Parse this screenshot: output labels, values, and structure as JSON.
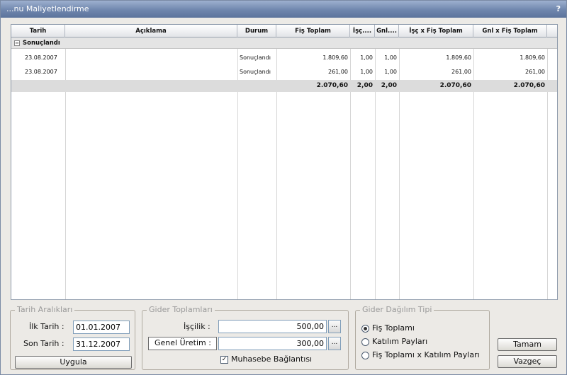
{
  "window": {
    "title": "...nu Maliyetlendirme",
    "help": "?"
  },
  "grid": {
    "columns": [
      "Tarih",
      "Açıklama",
      "Durum",
      "Fiş Toplam",
      "İşç....",
      "Gnl....",
      "İşç x Fiş Toplam",
      "Gnl x Fiş Toplam"
    ],
    "group_label": "Sonuçlandı",
    "group_toggle": "−",
    "rows": [
      {
        "tarih": "23.08.2007",
        "aciklama": "",
        "durum": "Sonuçlandı",
        "fis_toplam": "1.809,60",
        "isc": "1,00",
        "gnl": "1,00",
        "isc_x_fis": "1.809,60",
        "gnl_x_fis": "1.809,60"
      },
      {
        "tarih": "23.08.2007",
        "aciklama": "",
        "durum": "Sonuçlandı",
        "fis_toplam": "261,00",
        "isc": "1,00",
        "gnl": "1,00",
        "isc_x_fis": "261,00",
        "gnl_x_fis": "261,00"
      }
    ],
    "totals": {
      "fis_toplam": "2.070,60",
      "isc": "2,00",
      "gnl": "2,00",
      "isc_x_fis": "2.070,60",
      "gnl_x_fis": "2.070,60"
    }
  },
  "date_range": {
    "legend": "Tarih Aralıkları",
    "start_label": "İlk Tarih :",
    "start_value": "01.01.2007",
    "end_label": "Son Tarih :",
    "end_value": "31.12.2007",
    "apply_button": "Uygula"
  },
  "expense_totals": {
    "legend": "Gider Toplamları",
    "labor_label": "İşçilik :",
    "labor_value": "500,00",
    "general_label": "Genel Üretim :",
    "general_value": "300,00",
    "ellipsis": "...",
    "accounting_label": "Muhasebe Bağlantısı",
    "accounting_checked": true
  },
  "distribution": {
    "legend": "Gider Dağılım Tipi",
    "options": [
      "Fiş Toplamı",
      "Katılım Payları",
      "Fiş Toplamı x Katılım Payları"
    ],
    "selected_index": 0
  },
  "actions": {
    "ok": "Tamam",
    "cancel": "Vazgeç"
  }
}
